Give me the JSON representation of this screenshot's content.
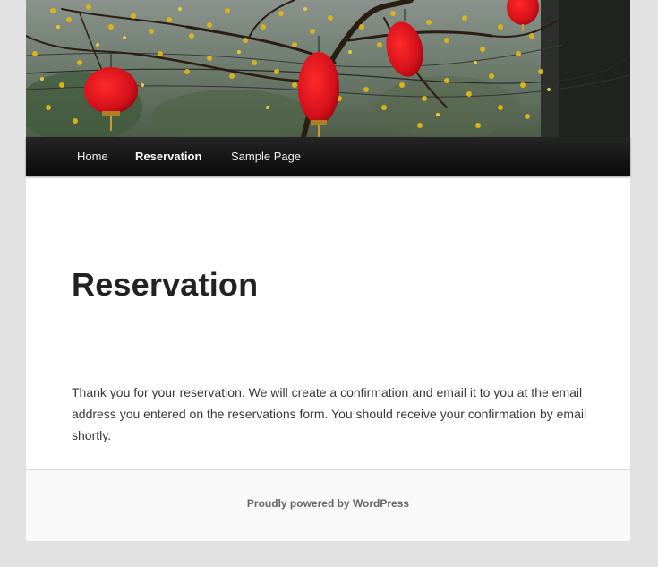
{
  "nav": {
    "items": [
      {
        "label": "Home",
        "current": false
      },
      {
        "label": "Reservation",
        "current": true
      },
      {
        "label": "Sample Page",
        "current": false
      }
    ]
  },
  "page": {
    "title": "Reservation",
    "content": "Thank you for your reservation. We will create a confirmation and email it to you at the email address you entered on the reservations form. You should receive your confirmation by email shortly."
  },
  "footer": {
    "credit": "Proudly powered by WordPress"
  },
  "colors": {
    "nav_background": "#111111",
    "lantern": "#d8141c",
    "blossom": "#d9b21c"
  }
}
